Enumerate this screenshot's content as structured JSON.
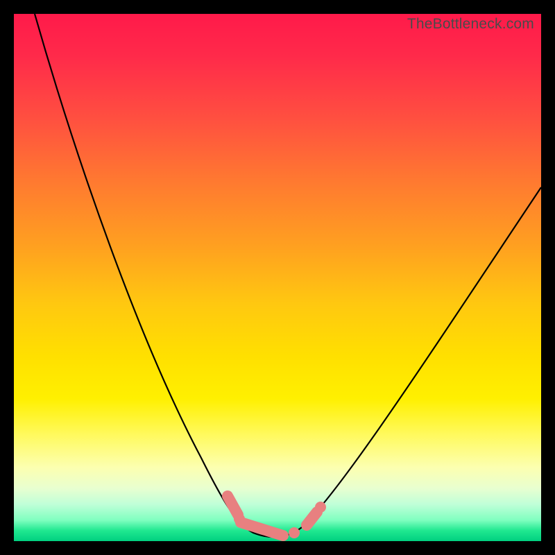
{
  "watermark": "TheBottleneck.com",
  "chart_data": {
    "type": "line",
    "title": "",
    "xlabel": "",
    "ylabel": "",
    "xlim": [
      0,
      100
    ],
    "ylim": [
      0,
      100
    ],
    "grid": false,
    "legend": false,
    "series": [
      {
        "name": "curve",
        "x": [
          4,
          6,
          10,
          15,
          20,
          25,
          30,
          34,
          37,
          40,
          42,
          44,
          46,
          48,
          50,
          52,
          54,
          56,
          60,
          65,
          70,
          75,
          80,
          85,
          90,
          95,
          100
        ],
        "y": [
          100,
          93,
          81,
          67,
          54,
          42,
          31,
          22,
          15,
          10,
          6,
          4,
          2,
          1,
          1,
          1,
          2,
          4,
          9,
          17,
          25,
          33,
          41,
          49,
          56,
          62,
          67
        ]
      }
    ],
    "markers": [
      {
        "shape": "segment",
        "x0": 40.5,
        "y0": 8.5,
        "x1": 42.5,
        "y1": 5.0,
        "color": "#e88080"
      },
      {
        "shape": "segment",
        "x0": 43.0,
        "y0": 3.5,
        "x1": 51.0,
        "y1": 1.0,
        "color": "#e88080"
      },
      {
        "shape": "segment",
        "x0": 55.5,
        "y0": 3.0,
        "x1": 57.5,
        "y1": 5.5,
        "color": "#e88080"
      },
      {
        "shape": "dot",
        "x": 42.8,
        "y": 4.2,
        "r": 1.0,
        "color": "#e88080"
      },
      {
        "shape": "dot",
        "x": 53.2,
        "y": 1.6,
        "r": 1.0,
        "color": "#e88080"
      },
      {
        "shape": "dot",
        "x": 58.2,
        "y": 6.5,
        "r": 1.0,
        "color": "#e88080"
      }
    ],
    "background_gradient": {
      "top": "#ff1a4a",
      "mid": "#ffe000",
      "bottom": "#00d080"
    }
  }
}
